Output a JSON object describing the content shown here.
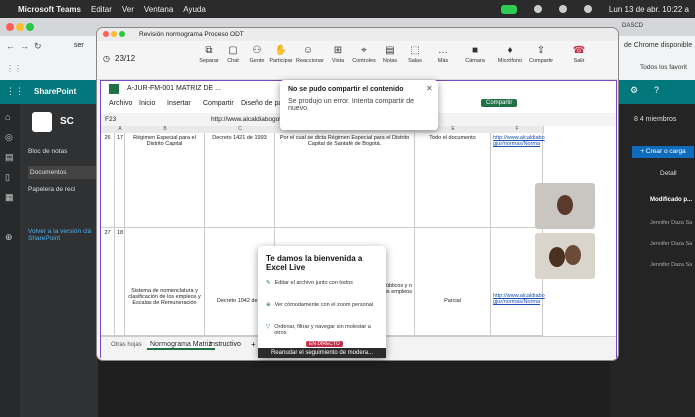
{
  "menubar": {
    "app": "Microsoft Teams",
    "items": [
      "Editar",
      "Ver",
      "Ventana",
      "Ayuda"
    ],
    "clock": "Lun 13 de abr. 10:22 a"
  },
  "browser": {
    "url_partial": "ser",
    "right_notice": "de Chrome disponible",
    "bookmarks_right": "Todos los favorit",
    "tab_label": "DASCD"
  },
  "sharepoint": {
    "title": "SharePoint",
    "site_abbr": "SC",
    "nav": [
      "Bloc de notas",
      "Documentos",
      "Papelera de reci"
    ],
    "classic": "Volver a la versión clá SharePoint",
    "members": "8 4 miembros",
    "create_btn": "+ Crear o carga",
    "detail": "Detall",
    "modified_header": "Modificado p...",
    "people": [
      "Jennifer Daza Sa",
      "Jennifer Daza Sa",
      "Jennifer Daza Sa"
    ]
  },
  "teams": {
    "window_title": "Revisión normograma Proceso ODT",
    "page_counter": "23/12",
    "toolbar": [
      "Separar",
      "Chat",
      "Gente",
      "Participar",
      "Reaccionar",
      "Vista",
      "Controles",
      "Notas",
      "Salas",
      "Más",
      "Cámara",
      "Micrófono",
      "Compartir",
      "Salir"
    ],
    "people_count": "2"
  },
  "excel": {
    "file": "A-JUR-FM-001 MATRIZ DE ...",
    "menu": [
      "Archivo",
      "Inicio",
      "Insertar",
      "Compartir",
      "Diseño de pá"
    ],
    "share_btn": "Compartir",
    "cellref": "F23",
    "formula": "http://www.alcaldiabogota.gov.co/sisjur/normas/Norma1.jsp?i=59353",
    "cols": [
      "A",
      "B",
      "C",
      "D",
      "E",
      "F"
    ],
    "row1": {
      "num": "26",
      "idx": "17",
      "b": "Régimen Especial para el Distrito Capital",
      "c": "Decreto 1421 de 1993",
      "d": "Por el cual se dicta Régimen Especial para el Distrito Capital de Santafé de Bogotá.",
      "e": "Todo el documento",
      "f": "http://www.alcaldiabo gjur/normas/Norma"
    },
    "row2": {
      "num": "27",
      "idx": "18",
      "b": "Sistema de nomenclatura y clasificación de los empleos y Escalas de Remuneración",
      "c": "Decreto 1042 de 1",
      "d": "nomenclatura y s, departamentos mientos públicos y n nacional, se fijan s a dichos empleos",
      "e": "Parcial",
      "f": "http://www.alcaldiabo gjur/normas/Norma"
    },
    "sheets": [
      "Normograma Matriz",
      "Instructivo",
      "+"
    ],
    "sheets_label": "Otras hojas"
  },
  "share_popup": {
    "title": "No se pudo compartir el contenido",
    "body": "Se produjo un error. Intenta compartir de nuevo."
  },
  "welcome": {
    "title": "Te damos la bienvenida a Excel Live",
    "items": [
      "Editar el archivo junto con todos",
      "Ver cómodamente con el zoom personal",
      "Ordenar, filtrar y navegar sin molestar a otros"
    ],
    "live_badge": "EN DIRECTO",
    "resume": "Reanudar el seguimiento de modera..."
  },
  "colors": {
    "sp_teal": "#03787c",
    "excel_green": "#1f7244",
    "teams_purple": "#7a4bc0"
  }
}
